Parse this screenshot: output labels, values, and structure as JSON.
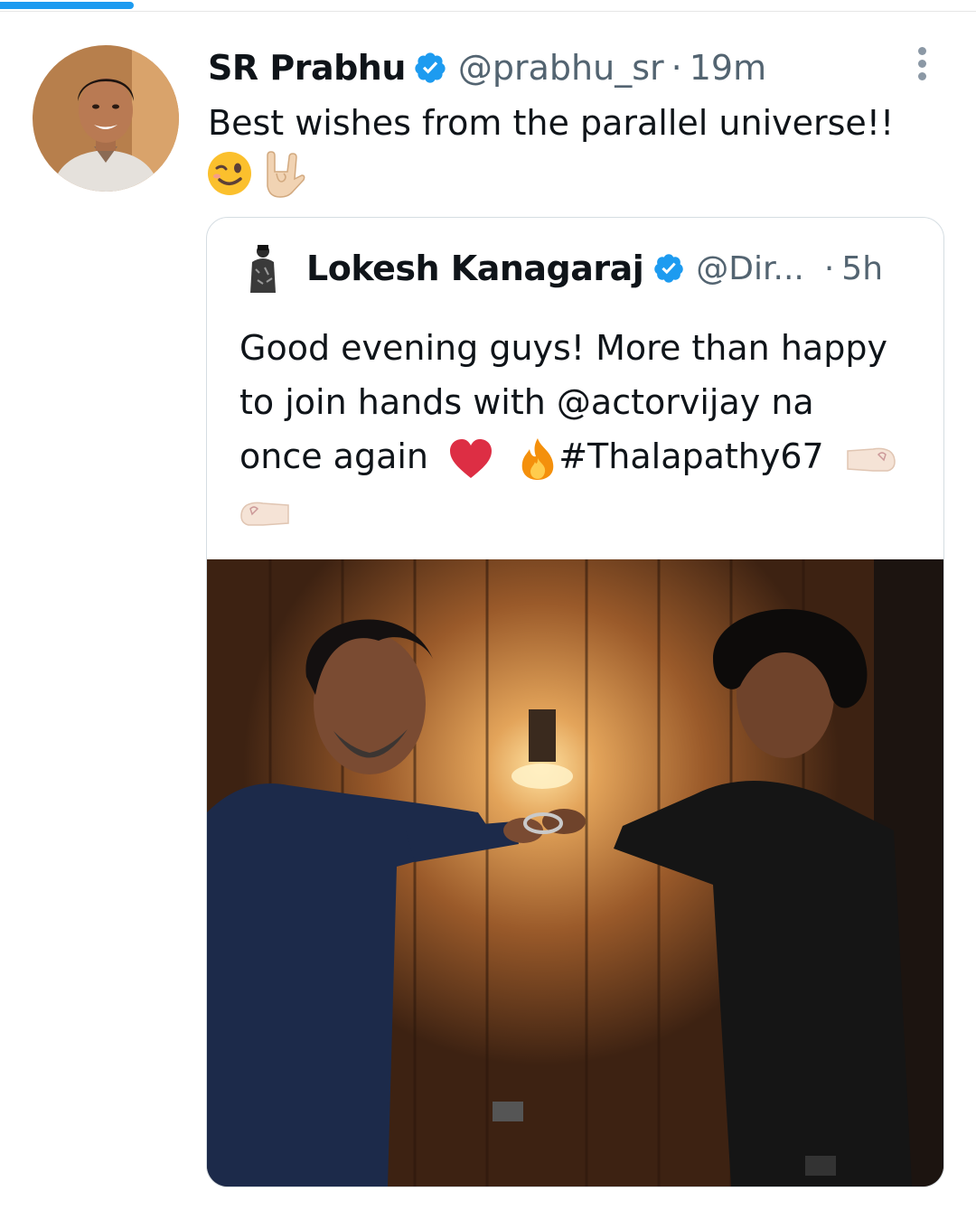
{
  "tweet": {
    "display_name": "SR Prabhu",
    "handle": "@prabhu_sr",
    "separator": "·",
    "time": "19m",
    "text": "Best wishes from the parallel universe!!",
    "emojis": [
      "winking-face",
      "sign-of-the-horns"
    ]
  },
  "quoted_tweet": {
    "display_name": "Lokesh Kanagaraj",
    "handle": "@Dir...",
    "separator": "·",
    "time": "5h",
    "text_line1": "Good evening guys! More than happy",
    "text_line2": "to join hands with @actorvijay na",
    "text_line3a": "once again",
    "text_line3b": "#Thalapathy67",
    "emojis": [
      "red-heart",
      "fire",
      "left-facing-fist",
      "right-facing-fist"
    ]
  },
  "colors": {
    "accent": "#1d9bf0",
    "secondary_text": "#536471",
    "border": "#d5dde2"
  }
}
